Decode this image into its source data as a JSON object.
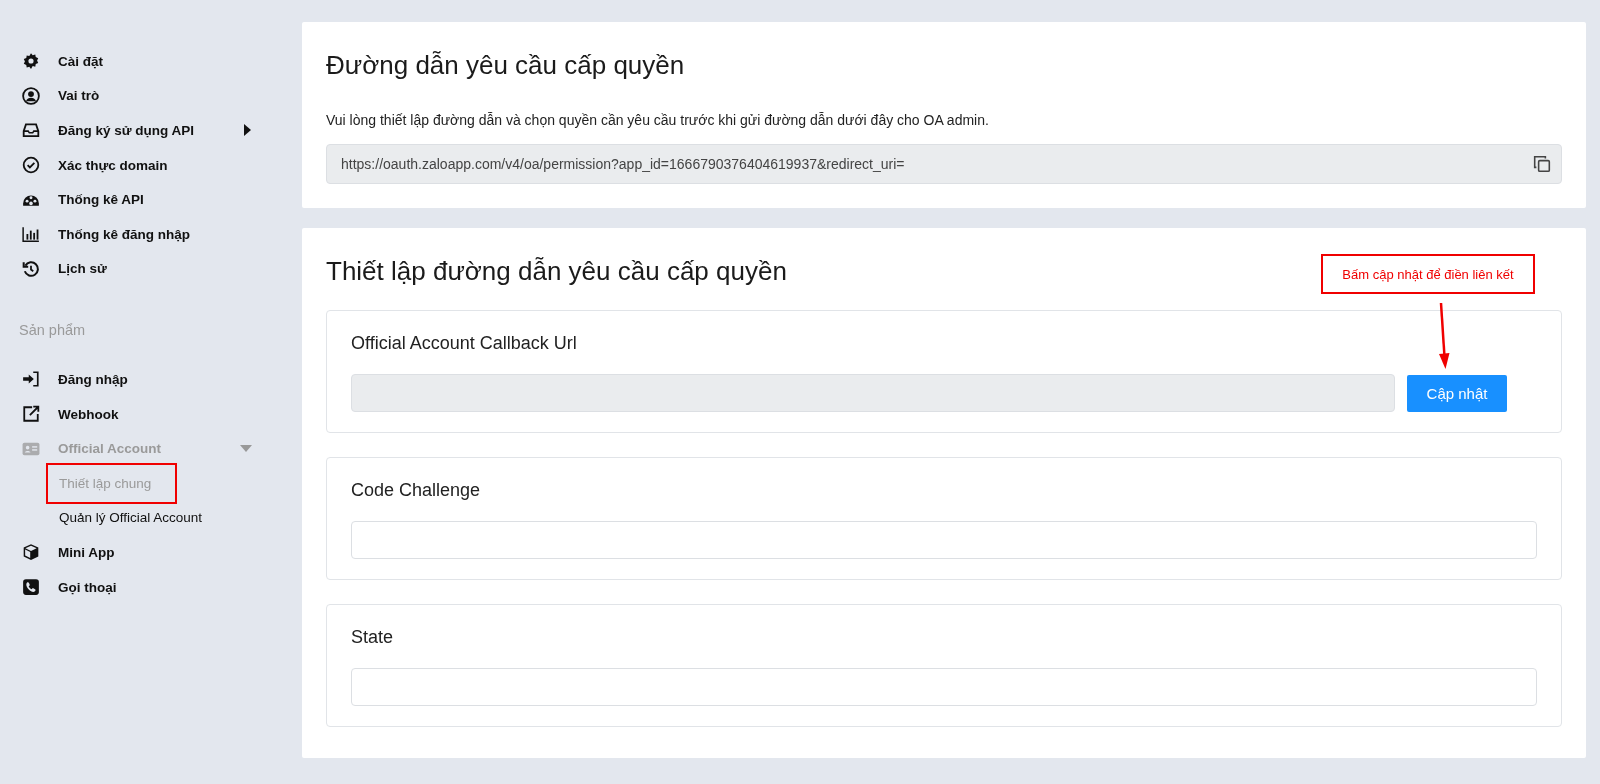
{
  "sidebar": {
    "items": [
      {
        "kind": "item",
        "label": "Cài đặt",
        "disabled": false
      },
      {
        "kind": "item",
        "label": "Vai trò",
        "disabled": false
      },
      {
        "kind": "item",
        "label": "Đăng ký sử dụng API",
        "disabled": false,
        "expanded": false
      },
      {
        "kind": "item",
        "label": "Xác thực domain",
        "disabled": false
      },
      {
        "kind": "item",
        "label": "Thống kê API",
        "disabled": false
      },
      {
        "kind": "item",
        "label": "Thống kê đăng nhập",
        "disabled": false
      },
      {
        "kind": "item",
        "label": "Lịch sử",
        "disabled": false
      },
      {
        "kind": "header",
        "label": "Sản phẩm"
      },
      {
        "kind": "item",
        "label": "Đăng nhập",
        "disabled": false
      },
      {
        "kind": "item",
        "label": "Webhook",
        "disabled": false
      },
      {
        "kind": "item",
        "label": "Official Account",
        "disabled": true,
        "expanded": true,
        "children": [
          {
            "label": "Thiết lập chung",
            "selected": true,
            "highlighted": true
          },
          {
            "label": "Quản lý Official Account",
            "selected": false,
            "highlighted": false
          }
        ]
      },
      {
        "kind": "item",
        "label": "Mini App",
        "disabled": false
      },
      {
        "kind": "item",
        "label": "Gọi thoại",
        "disabled": false
      }
    ]
  },
  "link_card": {
    "title": "Đường dẫn yêu cầu cấp quyền",
    "description": "Vui lòng thiết lập đường dẫn và chọn quyền cần yêu cầu trước khi gửi đường dẫn dưới đây cho OA admin.",
    "url": "https://oauth.zaloapp.com/v4/oa/permission?app_id=1666790376404619937&redirect_uri="
  },
  "settings_card": {
    "title": "Thiết lập đường dẫn yêu cầu cấp quyền",
    "annotation": "Bấm cập nhật để điền liên kết",
    "fields": [
      {
        "label": "Official Account Callback Url",
        "readonly": true,
        "button": "Cập nhật"
      },
      {
        "label": "Code Challenge",
        "readonly": false
      },
      {
        "label": "State",
        "readonly": false
      }
    ]
  }
}
